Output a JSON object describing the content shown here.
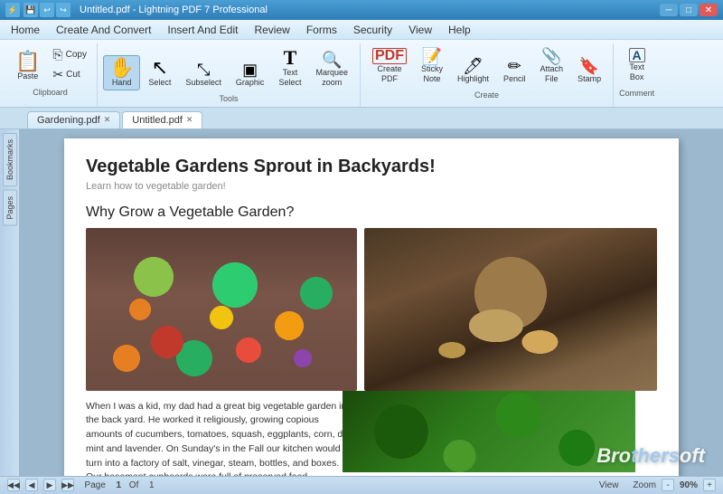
{
  "titleBar": {
    "title": "Untitled.pdf - Lightning PDF 7 Professional",
    "minBtn": "─",
    "maxBtn": "□",
    "closeBtn": "✕"
  },
  "menuBar": {
    "items": [
      "Home",
      "Create And Convert",
      "Insert And Edit",
      "Review",
      "Forms",
      "Security",
      "View",
      "Help"
    ]
  },
  "ribbon": {
    "groups": [
      {
        "label": "Clipboard",
        "buttons": [
          {
            "id": "paste",
            "label": "Paste",
            "icon": "📋",
            "size": "large"
          },
          {
            "id": "copy",
            "label": "Copy",
            "icon": "📄",
            "size": "small"
          },
          {
            "id": "cut",
            "label": "Cut",
            "icon": "✂",
            "size": "small"
          }
        ]
      },
      {
        "label": "Tools",
        "buttons": [
          {
            "id": "hand",
            "label": "Hand",
            "icon": "✋",
            "size": "large",
            "active": true
          },
          {
            "id": "select",
            "label": "Select",
            "icon": "↖",
            "size": "large"
          },
          {
            "id": "subselect",
            "label": "Subselect",
            "icon": "↗",
            "size": "large"
          },
          {
            "id": "graphic",
            "label": "Graphic",
            "icon": "⬜",
            "size": "large"
          },
          {
            "id": "text",
            "label": "Text\nSelect",
            "icon": "𝐓",
            "size": "large"
          },
          {
            "id": "marquee",
            "label": "Marquee\nzoom",
            "icon": "🔍",
            "size": "large"
          }
        ]
      },
      {
        "label": "Create",
        "buttons": [
          {
            "id": "create-pdf",
            "label": "Create\nPDF",
            "icon": "📄",
            "size": "large"
          },
          {
            "id": "sticky",
            "label": "Sticky\nNote",
            "icon": "📝",
            "size": "large"
          },
          {
            "id": "highlight",
            "label": "Highlight",
            "icon": "🖊",
            "size": "large"
          },
          {
            "id": "pencil",
            "label": "Pencil",
            "icon": "✏",
            "size": "large"
          },
          {
            "id": "attach",
            "label": "Attach\nFile",
            "icon": "📎",
            "size": "large"
          },
          {
            "id": "stamp",
            "label": "Stamp",
            "icon": "🔖",
            "size": "large"
          }
        ]
      },
      {
        "label": "Comment",
        "buttons": [
          {
            "id": "textbox",
            "label": "Text\nBox",
            "icon": "🔤",
            "size": "large"
          }
        ]
      }
    ]
  },
  "tabs": [
    {
      "label": "Gardening.pdf",
      "active": false
    },
    {
      "label": "Untitled.pdf",
      "active": true
    }
  ],
  "sidebar": {
    "bookmarks": "Bookmarks",
    "pages": "Pages"
  },
  "pdf": {
    "title": "Vegetable Gardens Sprout in Backyards!",
    "subtitle": "Learn how to vegetable garden!",
    "sectionTitle": "Why Grow a Vegetable Garden?",
    "bodyText": "When I was a kid, my dad had a great big vegetable garden in the back yard. He worked it religiously, growing copious amounts of cucumbers, tomatoes, squash, eggplants, corn, dill, mint and lavender. On Sunday's in the Fall our kitchen would turn into a factory of salt, vinegar, steam, bottles, and boxes. Our basement cupboards were full of preserved food"
  },
  "statusBar": {
    "pageLabel": "Page",
    "pageNum": "1",
    "ofLabel": "Of",
    "totalPages": "1",
    "viewLabel": "View",
    "zoomLabel": "Zoom",
    "zoomLevel": "90%"
  },
  "watermark": {
    "text": "Bro",
    "text2": "thers",
    "suffix": "oft"
  }
}
